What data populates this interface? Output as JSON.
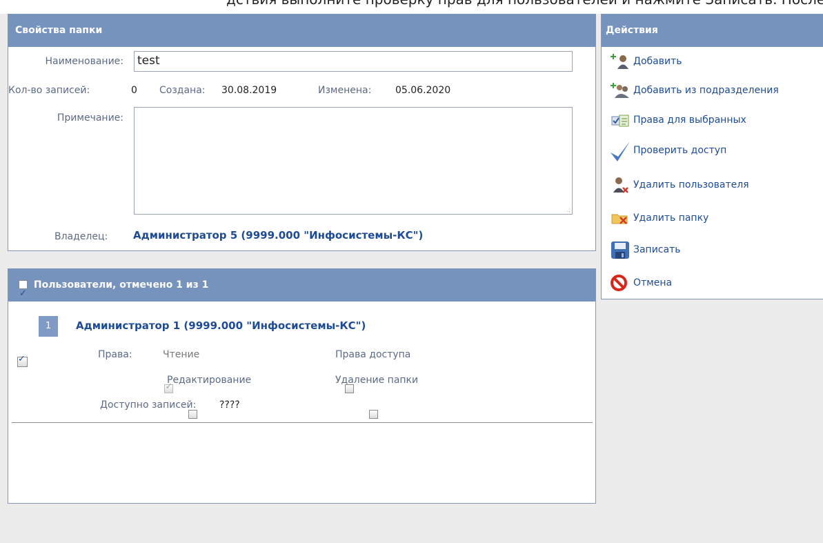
{
  "top_text": "дствия выполните проверку прав для пользователей и нажмите Записать. После чего можно отправить пользователям уведомление",
  "folder": {
    "header": "Свойства папки",
    "name_label": "Наименование:",
    "name_value": "test",
    "count_label": "Кол-во записей:",
    "count_value": "0",
    "created_label": "Создана:",
    "created_value": "30.08.2019",
    "modified_label": "Изменена:",
    "modified_value": "05.06.2020",
    "note_label": "Примечание:",
    "note_value": "",
    "owner_label": "Владелец:",
    "owner_value": "Администратор 5 (9999.000 \"Инфосистемы-КС\")"
  },
  "users": {
    "header": "Пользователи, отмечено 1 из 1",
    "items": [
      {
        "index": "1",
        "name": "Администратор 1 (9999.000 \"Инфосистемы-КС\")",
        "rights_label": "Права:",
        "read": "Чтение",
        "edit": "Редактирование",
        "access": "Права доступа",
        "delete": "Удаление папки",
        "available_label": "Доступно записей:",
        "available_value": "????"
      }
    ]
  },
  "actions": {
    "header": "Действия",
    "items": [
      {
        "label": "Добавить",
        "icon": "add-user-icon"
      },
      {
        "label": "Добавить из подразделения",
        "icon": "add-group-icon"
      },
      {
        "label": "Права для выбранных",
        "icon": "rights-icon"
      },
      {
        "label": "Проверить доступ",
        "icon": "checkmark-icon"
      },
      {
        "label": "Удалить пользователя",
        "icon": "remove-user-icon"
      },
      {
        "label": "Удалить папку",
        "icon": "delete-folder-icon"
      },
      {
        "label": "Записать",
        "icon": "save-icon"
      },
      {
        "label": "Отмена",
        "icon": "cancel-icon"
      }
    ]
  }
}
